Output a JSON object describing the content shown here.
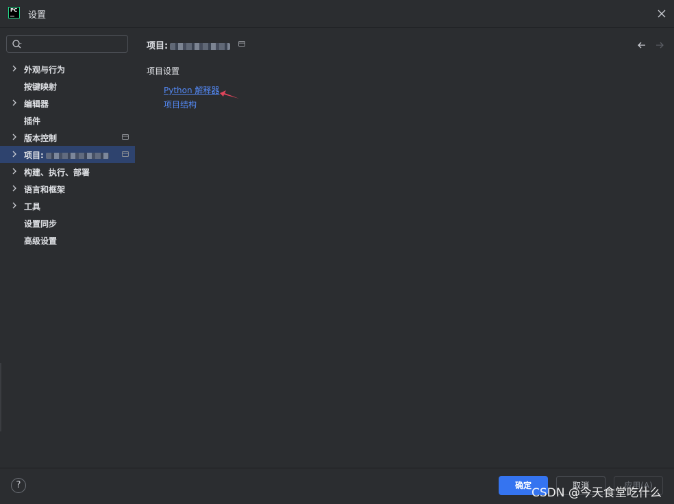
{
  "window": {
    "title": "设置"
  },
  "search": {
    "placeholder": "",
    "value": ""
  },
  "sidebar": {
    "items": [
      {
        "label": "外观与行为",
        "expandable": true
      },
      {
        "label": "按键映射",
        "expandable": false
      },
      {
        "label": "编辑器",
        "expandable": true
      },
      {
        "label": "插件",
        "expandable": false
      },
      {
        "label": "版本控制",
        "expandable": true,
        "project_icon": true
      },
      {
        "label": "项目:",
        "expandable": true,
        "selected": true,
        "project_icon": true
      },
      {
        "label": "构建、执行、部署",
        "expandable": true
      },
      {
        "label": "语言和框架",
        "expandable": true
      },
      {
        "label": "工具",
        "expandable": true
      },
      {
        "label": "设置同步",
        "expandable": false
      },
      {
        "label": "高级设置",
        "expandable": false
      }
    ]
  },
  "main": {
    "breadcrumb": "项目:",
    "section_title": "项目设置",
    "links": [
      {
        "label": "Python 解释器"
      },
      {
        "label": "项目结构"
      }
    ]
  },
  "footer": {
    "help": "?",
    "ok": "确定",
    "cancel": "取消",
    "apply": "应用(A)",
    "watermark": "CSDN @今天食堂吃什么"
  },
  "colors": {
    "background": "#2b2d30",
    "selection": "#2e436e",
    "link": "#548af7",
    "primary_button": "#3574f0",
    "annotation_arrow": "#e0455b"
  }
}
